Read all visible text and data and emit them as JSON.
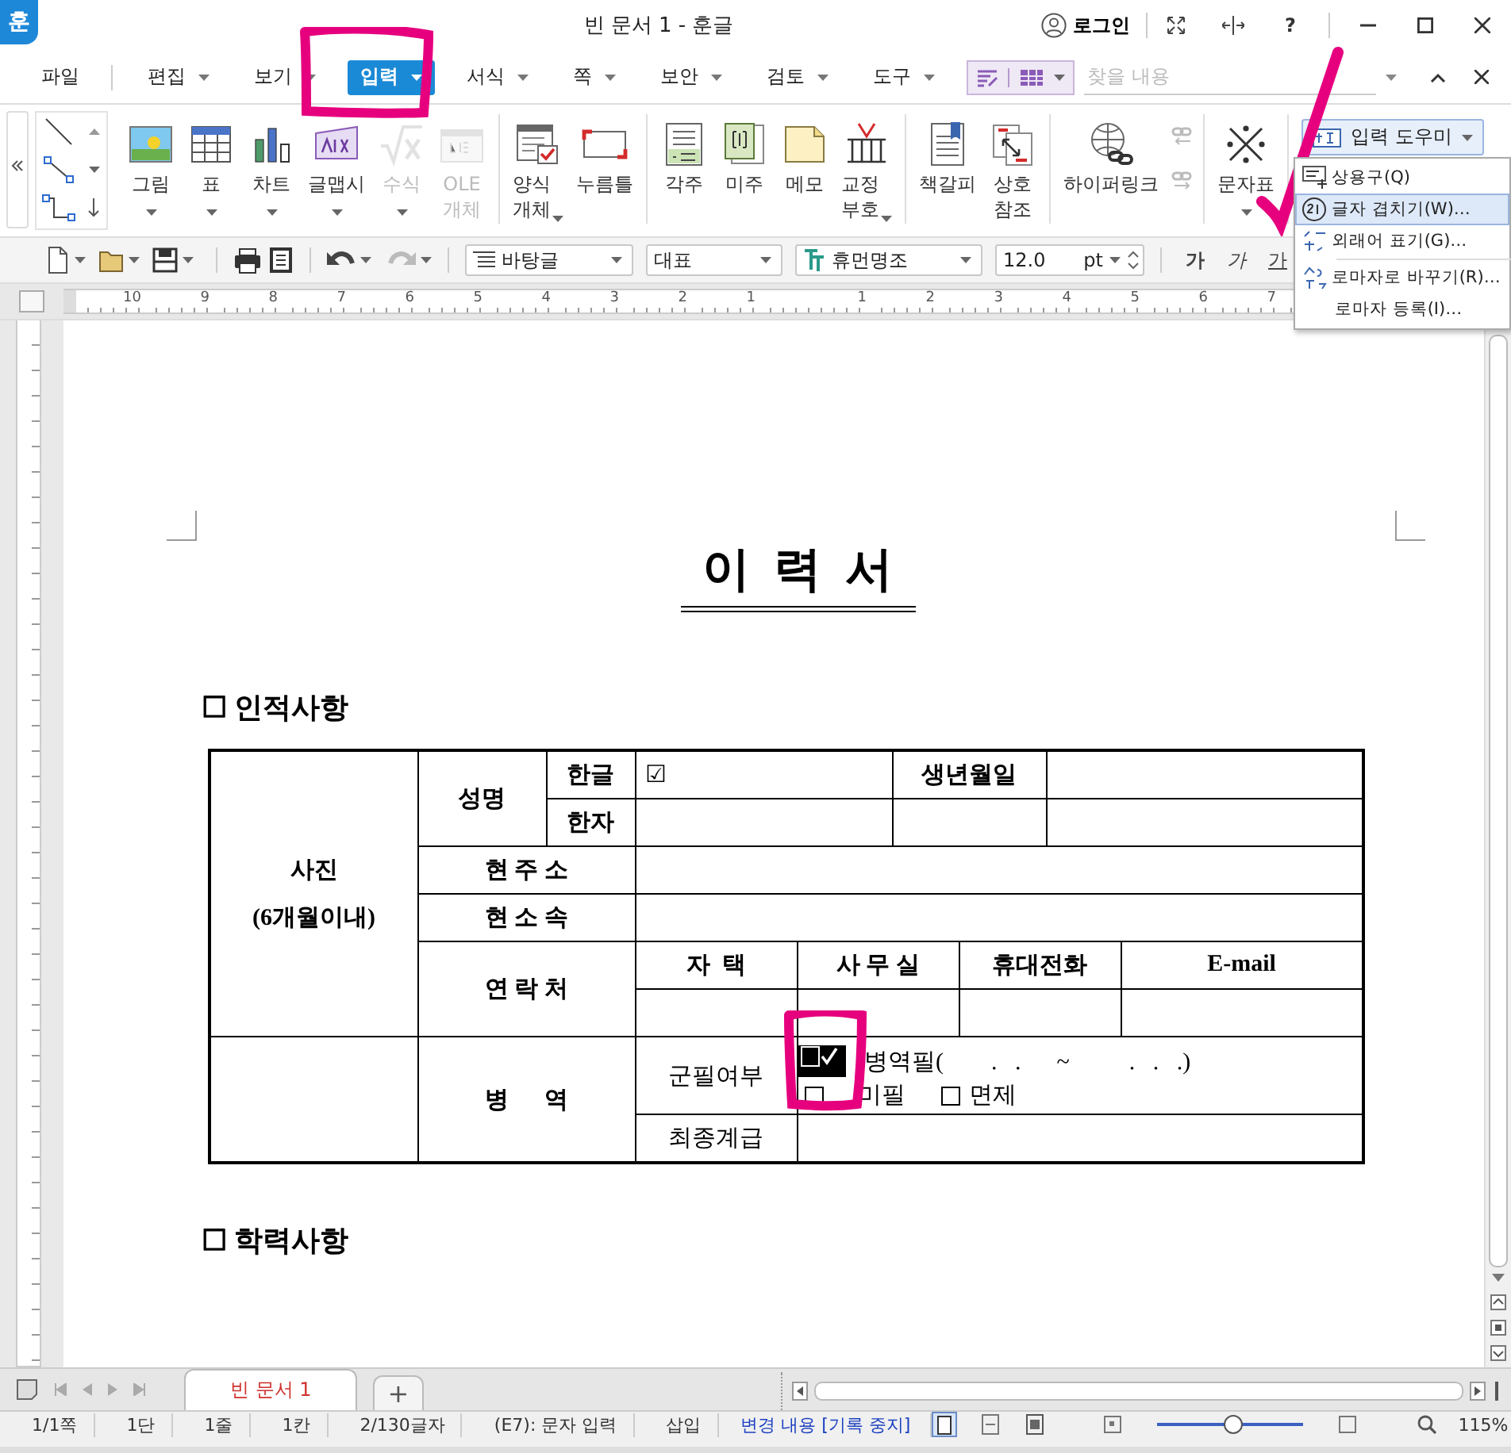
{
  "title_bar": {
    "logo": "훈",
    "title": "빈 문서 1 - 훈글",
    "login": "로그인",
    "help": "?"
  },
  "menu_bar": {
    "items": [
      {
        "label": "파일",
        "dropdown": false,
        "selected": false
      },
      {
        "label": "편집",
        "dropdown": true,
        "selected": false
      },
      {
        "label": "보기",
        "dropdown": true,
        "selected": false
      },
      {
        "label": "입력",
        "dropdown": true,
        "selected": true
      },
      {
        "label": "서식",
        "dropdown": true,
        "selected": false
      },
      {
        "label": "쪽",
        "dropdown": true,
        "selected": false
      },
      {
        "label": "보안",
        "dropdown": true,
        "selected": false
      },
      {
        "label": "검토",
        "dropdown": true,
        "selected": false
      },
      {
        "label": "도구",
        "dropdown": true,
        "selected": false
      }
    ],
    "search": {
      "placeholder": "찾을 내용"
    }
  },
  "ribbon": {
    "groups": [
      {
        "items": [
          {
            "label": "그림",
            "dropdown": true,
            "disabled": false
          },
          {
            "label": "표",
            "dropdown": true,
            "disabled": false
          },
          {
            "label": "차트",
            "dropdown": true,
            "disabled": false
          },
          {
            "label": "글맵시",
            "dropdown": true,
            "disabled": false
          },
          {
            "label": "수식",
            "dropdown": true,
            "disabled": true
          },
          {
            "label": "OLE\n개체",
            "dropdown": false,
            "disabled": true
          }
        ]
      },
      {
        "items": [
          {
            "label": "양식\n개체",
            "dropdown": true,
            "disabled": false
          },
          {
            "label": "누름틀",
            "dropdown": false,
            "disabled": false
          }
        ]
      },
      {
        "items": [
          {
            "label": "각주",
            "dropdown": false,
            "disabled": false
          },
          {
            "label": "미주",
            "dropdown": false,
            "disabled": false
          },
          {
            "label": "메모",
            "dropdown": false,
            "disabled": false
          },
          {
            "label": "교정\n부호",
            "dropdown": true,
            "disabled": false
          }
        ]
      },
      {
        "items": [
          {
            "label": "책갈피",
            "dropdown": false,
            "disabled": false
          },
          {
            "label": "상호\n참조",
            "dropdown": false,
            "disabled": false
          }
        ]
      },
      {
        "items": [
          {
            "label": "하이퍼링크",
            "dropdown": false,
            "disabled": false
          }
        ]
      },
      {
        "items": [
          {
            "label": "문자표",
            "dropdown": true,
            "disabled": false
          }
        ]
      }
    ],
    "input_helper": {
      "label": "입력 도우미"
    }
  },
  "input_helper_menu": {
    "items": [
      {
        "label": "상용구(Q)",
        "selected": false
      },
      {
        "label": "글자 겹치기(W)…",
        "selected": true
      },
      {
        "label": "외래어 표기(G)…",
        "selected": false
      },
      {
        "label": "로마자로 바꾸기(R)…",
        "selected": false
      },
      {
        "label": "로마자 등록(I)…",
        "selected": false
      }
    ]
  },
  "format_bar": {
    "style": "바탕글",
    "language": "대표",
    "font": "휴먼명조",
    "size": "12.0",
    "unit": "pt",
    "char_buttons": [
      "가",
      "가",
      "가"
    ]
  },
  "ruler": {
    "numbers": [
      "10",
      "9",
      "8",
      "7",
      "6",
      "5",
      "4",
      "3",
      "2",
      "1",
      "1",
      "2",
      "3",
      "4",
      "5",
      "6",
      "7"
    ]
  },
  "document": {
    "title": "이  력  서",
    "section_1": "☐ 인적사항",
    "table": {
      "photo": "사진",
      "photo_note": "(6개월이내)",
      "name": "성명",
      "hangul": "한글",
      "hangul_value": "☑",
      "hanja": "한자",
      "birth": "생년월일",
      "address": "현 주 소",
      "affiliation": "현 소 속",
      "contact": "연 락 처",
      "contact_columns": [
        "자  택",
        "사 무 실",
        "휴대전화",
        "E-mail"
      ],
      "military": "병      역",
      "service": "군필여부",
      "options": [
        {
          "label": "병역필(        .   .      ~          .   .   .)",
          "checked": true
        },
        {
          "label": "미필",
          "checked": false
        },
        {
          "label": "면제",
          "checked": false
        }
      ],
      "rank": "최종계급"
    },
    "section_2": "☐ 학력사항"
  },
  "tab_bar": {
    "tabs": [
      {
        "label": "빈 문서 1",
        "selected": true
      }
    ],
    "add": "+"
  },
  "status_bar": {
    "fields": [
      "1/1쪽",
      "1단",
      "1줄",
      "1칸",
      "2/130글자",
      "(E7): 문자 입력",
      "삽입"
    ],
    "track_changes": "변경 내용 [기록 중지]",
    "zoom_slider": {
      "level": 0.52
    },
    "zoom": "115%"
  }
}
